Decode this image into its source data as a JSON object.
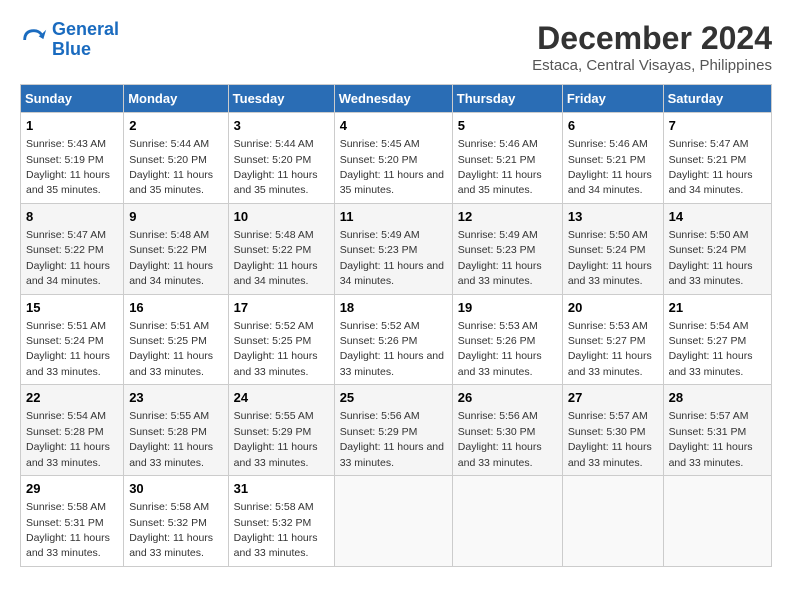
{
  "logo": {
    "line1": "General",
    "line2": "Blue"
  },
  "title": "December 2024",
  "subtitle": "Estaca, Central Visayas, Philippines",
  "headers": [
    "Sunday",
    "Monday",
    "Tuesday",
    "Wednesday",
    "Thursday",
    "Friday",
    "Saturday"
  ],
  "weeks": [
    [
      {
        "day": "1",
        "sunrise": "5:43 AM",
        "sunset": "5:19 PM",
        "daylight": "11 hours and 35 minutes."
      },
      {
        "day": "2",
        "sunrise": "5:44 AM",
        "sunset": "5:20 PM",
        "daylight": "11 hours and 35 minutes."
      },
      {
        "day": "3",
        "sunrise": "5:44 AM",
        "sunset": "5:20 PM",
        "daylight": "11 hours and 35 minutes."
      },
      {
        "day": "4",
        "sunrise": "5:45 AM",
        "sunset": "5:20 PM",
        "daylight": "11 hours and 35 minutes."
      },
      {
        "day": "5",
        "sunrise": "5:46 AM",
        "sunset": "5:21 PM",
        "daylight": "11 hours and 35 minutes."
      },
      {
        "day": "6",
        "sunrise": "5:46 AM",
        "sunset": "5:21 PM",
        "daylight": "11 hours and 34 minutes."
      },
      {
        "day": "7",
        "sunrise": "5:47 AM",
        "sunset": "5:21 PM",
        "daylight": "11 hours and 34 minutes."
      }
    ],
    [
      {
        "day": "8",
        "sunrise": "5:47 AM",
        "sunset": "5:22 PM",
        "daylight": "11 hours and 34 minutes."
      },
      {
        "day": "9",
        "sunrise": "5:48 AM",
        "sunset": "5:22 PM",
        "daylight": "11 hours and 34 minutes."
      },
      {
        "day": "10",
        "sunrise": "5:48 AM",
        "sunset": "5:22 PM",
        "daylight": "11 hours and 34 minutes."
      },
      {
        "day": "11",
        "sunrise": "5:49 AM",
        "sunset": "5:23 PM",
        "daylight": "11 hours and 34 minutes."
      },
      {
        "day": "12",
        "sunrise": "5:49 AM",
        "sunset": "5:23 PM",
        "daylight": "11 hours and 33 minutes."
      },
      {
        "day": "13",
        "sunrise": "5:50 AM",
        "sunset": "5:24 PM",
        "daylight": "11 hours and 33 minutes."
      },
      {
        "day": "14",
        "sunrise": "5:50 AM",
        "sunset": "5:24 PM",
        "daylight": "11 hours and 33 minutes."
      }
    ],
    [
      {
        "day": "15",
        "sunrise": "5:51 AM",
        "sunset": "5:24 PM",
        "daylight": "11 hours and 33 minutes."
      },
      {
        "day": "16",
        "sunrise": "5:51 AM",
        "sunset": "5:25 PM",
        "daylight": "11 hours and 33 minutes."
      },
      {
        "day": "17",
        "sunrise": "5:52 AM",
        "sunset": "5:25 PM",
        "daylight": "11 hours and 33 minutes."
      },
      {
        "day": "18",
        "sunrise": "5:52 AM",
        "sunset": "5:26 PM",
        "daylight": "11 hours and 33 minutes."
      },
      {
        "day": "19",
        "sunrise": "5:53 AM",
        "sunset": "5:26 PM",
        "daylight": "11 hours and 33 minutes."
      },
      {
        "day": "20",
        "sunrise": "5:53 AM",
        "sunset": "5:27 PM",
        "daylight": "11 hours and 33 minutes."
      },
      {
        "day": "21",
        "sunrise": "5:54 AM",
        "sunset": "5:27 PM",
        "daylight": "11 hours and 33 minutes."
      }
    ],
    [
      {
        "day": "22",
        "sunrise": "5:54 AM",
        "sunset": "5:28 PM",
        "daylight": "11 hours and 33 minutes."
      },
      {
        "day": "23",
        "sunrise": "5:55 AM",
        "sunset": "5:28 PM",
        "daylight": "11 hours and 33 minutes."
      },
      {
        "day": "24",
        "sunrise": "5:55 AM",
        "sunset": "5:29 PM",
        "daylight": "11 hours and 33 minutes."
      },
      {
        "day": "25",
        "sunrise": "5:56 AM",
        "sunset": "5:29 PM",
        "daylight": "11 hours and 33 minutes."
      },
      {
        "day": "26",
        "sunrise": "5:56 AM",
        "sunset": "5:30 PM",
        "daylight": "11 hours and 33 minutes."
      },
      {
        "day": "27",
        "sunrise": "5:57 AM",
        "sunset": "5:30 PM",
        "daylight": "11 hours and 33 minutes."
      },
      {
        "day": "28",
        "sunrise": "5:57 AM",
        "sunset": "5:31 PM",
        "daylight": "11 hours and 33 minutes."
      }
    ],
    [
      {
        "day": "29",
        "sunrise": "5:58 AM",
        "sunset": "5:31 PM",
        "daylight": "11 hours and 33 minutes."
      },
      {
        "day": "30",
        "sunrise": "5:58 AM",
        "sunset": "5:32 PM",
        "daylight": "11 hours and 33 minutes."
      },
      {
        "day": "31",
        "sunrise": "5:58 AM",
        "sunset": "5:32 PM",
        "daylight": "11 hours and 33 minutes."
      },
      null,
      null,
      null,
      null
    ]
  ]
}
